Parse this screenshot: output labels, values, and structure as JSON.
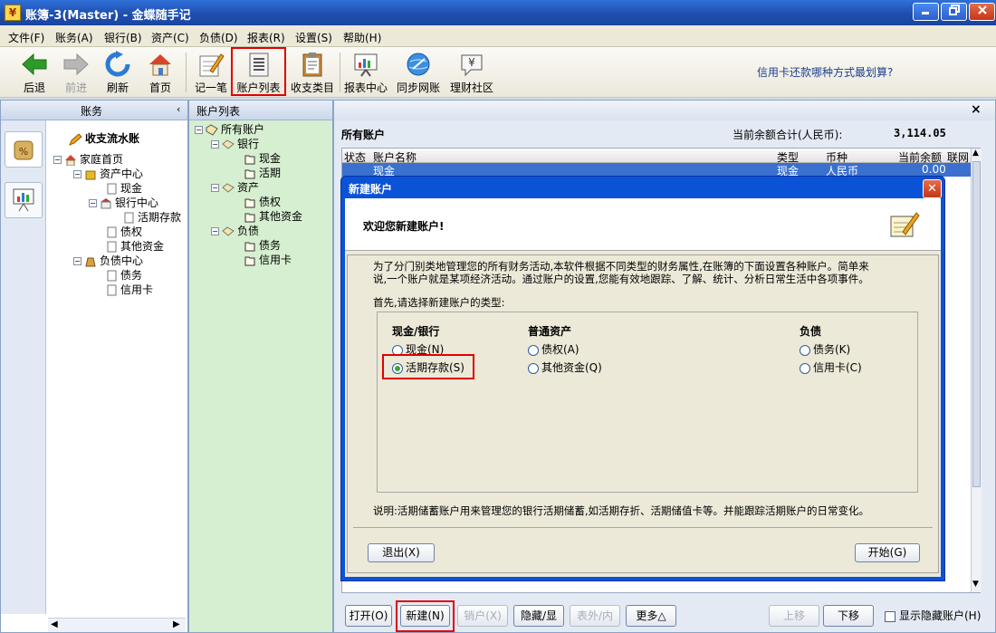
{
  "window": {
    "app_icon": "¥",
    "title": "账簿-3(Master) - 金蝶随手记"
  },
  "menu": [
    "文件(F)",
    "账务(A)",
    "银行(B)",
    "资产(C)",
    "负债(D)",
    "报表(R)",
    "设置(S)",
    "帮助(H)"
  ],
  "toolbar": {
    "back": "后退",
    "forward": "前进",
    "refresh": "刷新",
    "home": "首页",
    "record": "记一笔",
    "account_list": "账户列表",
    "categories": "收支类目",
    "reports": "报表中心",
    "sync": "同步网账",
    "community": "理财社区",
    "promo": "信用卡还款哪种方式最划算?"
  },
  "left_panel": {
    "title": "账务",
    "ledger": "收支流水账",
    "tree": {
      "home": "家庭首页",
      "asset_center": "资产中心",
      "cash": "现金",
      "bank_center": "银行中心",
      "demand_deposit": "活期存款",
      "claims": "债权",
      "other_funds": "其他资金",
      "liability_center": "负债中心",
      "debts": "债务",
      "credit_card": "信用卡"
    }
  },
  "mid_panel": {
    "title": "账户列表",
    "tree": {
      "all": "所有账户",
      "bank": "银行",
      "cash": "现金",
      "demand": "活期",
      "asset": "资产",
      "claims": "债权",
      "other_funds": "其他资金",
      "liability": "负债",
      "debts": "债务",
      "credit_card": "信用卡"
    }
  },
  "right_panel": {
    "close": "×",
    "title": "所有账户",
    "total_label": "当前余额合计(人民币):",
    "total_value": "3,114.05",
    "columns": {
      "status": "状态",
      "name": "账户名称",
      "type": "类型",
      "currency": "币种",
      "balance": "当前余额",
      "online": "联网"
    },
    "row": {
      "name": "现金",
      "type": "现金",
      "currency": "人民币",
      "balance": "0.00"
    },
    "buttons": {
      "open": "打开(O)",
      "new": "新建(N)",
      "delete": "销户(X)",
      "hide": "隐藏/显",
      "table": "表外/内",
      "more": "更多△",
      "up": "上移",
      "down": "下移"
    },
    "show_hidden": "显示隐藏账户(H)"
  },
  "dialog": {
    "title": "新建账户",
    "close": "✕",
    "welcome": "欢迎您新建账户!",
    "intro1": "为了分门别类地管理您的所有财务活动,本软件根据不同类型的财务属性,在账簿的下面设置各种账户。简单来",
    "intro2": "说,一个账户就是某项经济活动。通过账户的设置,您能有效地跟踪、了解、统计、分析日常生活中各项事件。",
    "prompt": "首先,请选择新建账户的类型:",
    "groups": {
      "cash_bank": "现金/银行",
      "general_asset": "普通资产",
      "liability": "负债"
    },
    "options": {
      "cash": "现金(N)",
      "demand_deposit": "活期存款(S)",
      "claims": "债权(A)",
      "other_funds": "其他资金(Q)",
      "debts": "债务(K)",
      "credit_card": "信用卡(C)"
    },
    "note": "说明:活期储蓄账户用来管理您的银行活期储蓄,如活期存折、活期储值卡等。并能跟踪活期账户的日常变化。",
    "exit_button": "退出(X)",
    "start_button": "开始(G)"
  },
  "colors": {
    "title_bar": "#1e4fae",
    "selection": "#3b70cf",
    "highlight_box": "#e00000",
    "mid_bg": "#d6efd0"
  }
}
